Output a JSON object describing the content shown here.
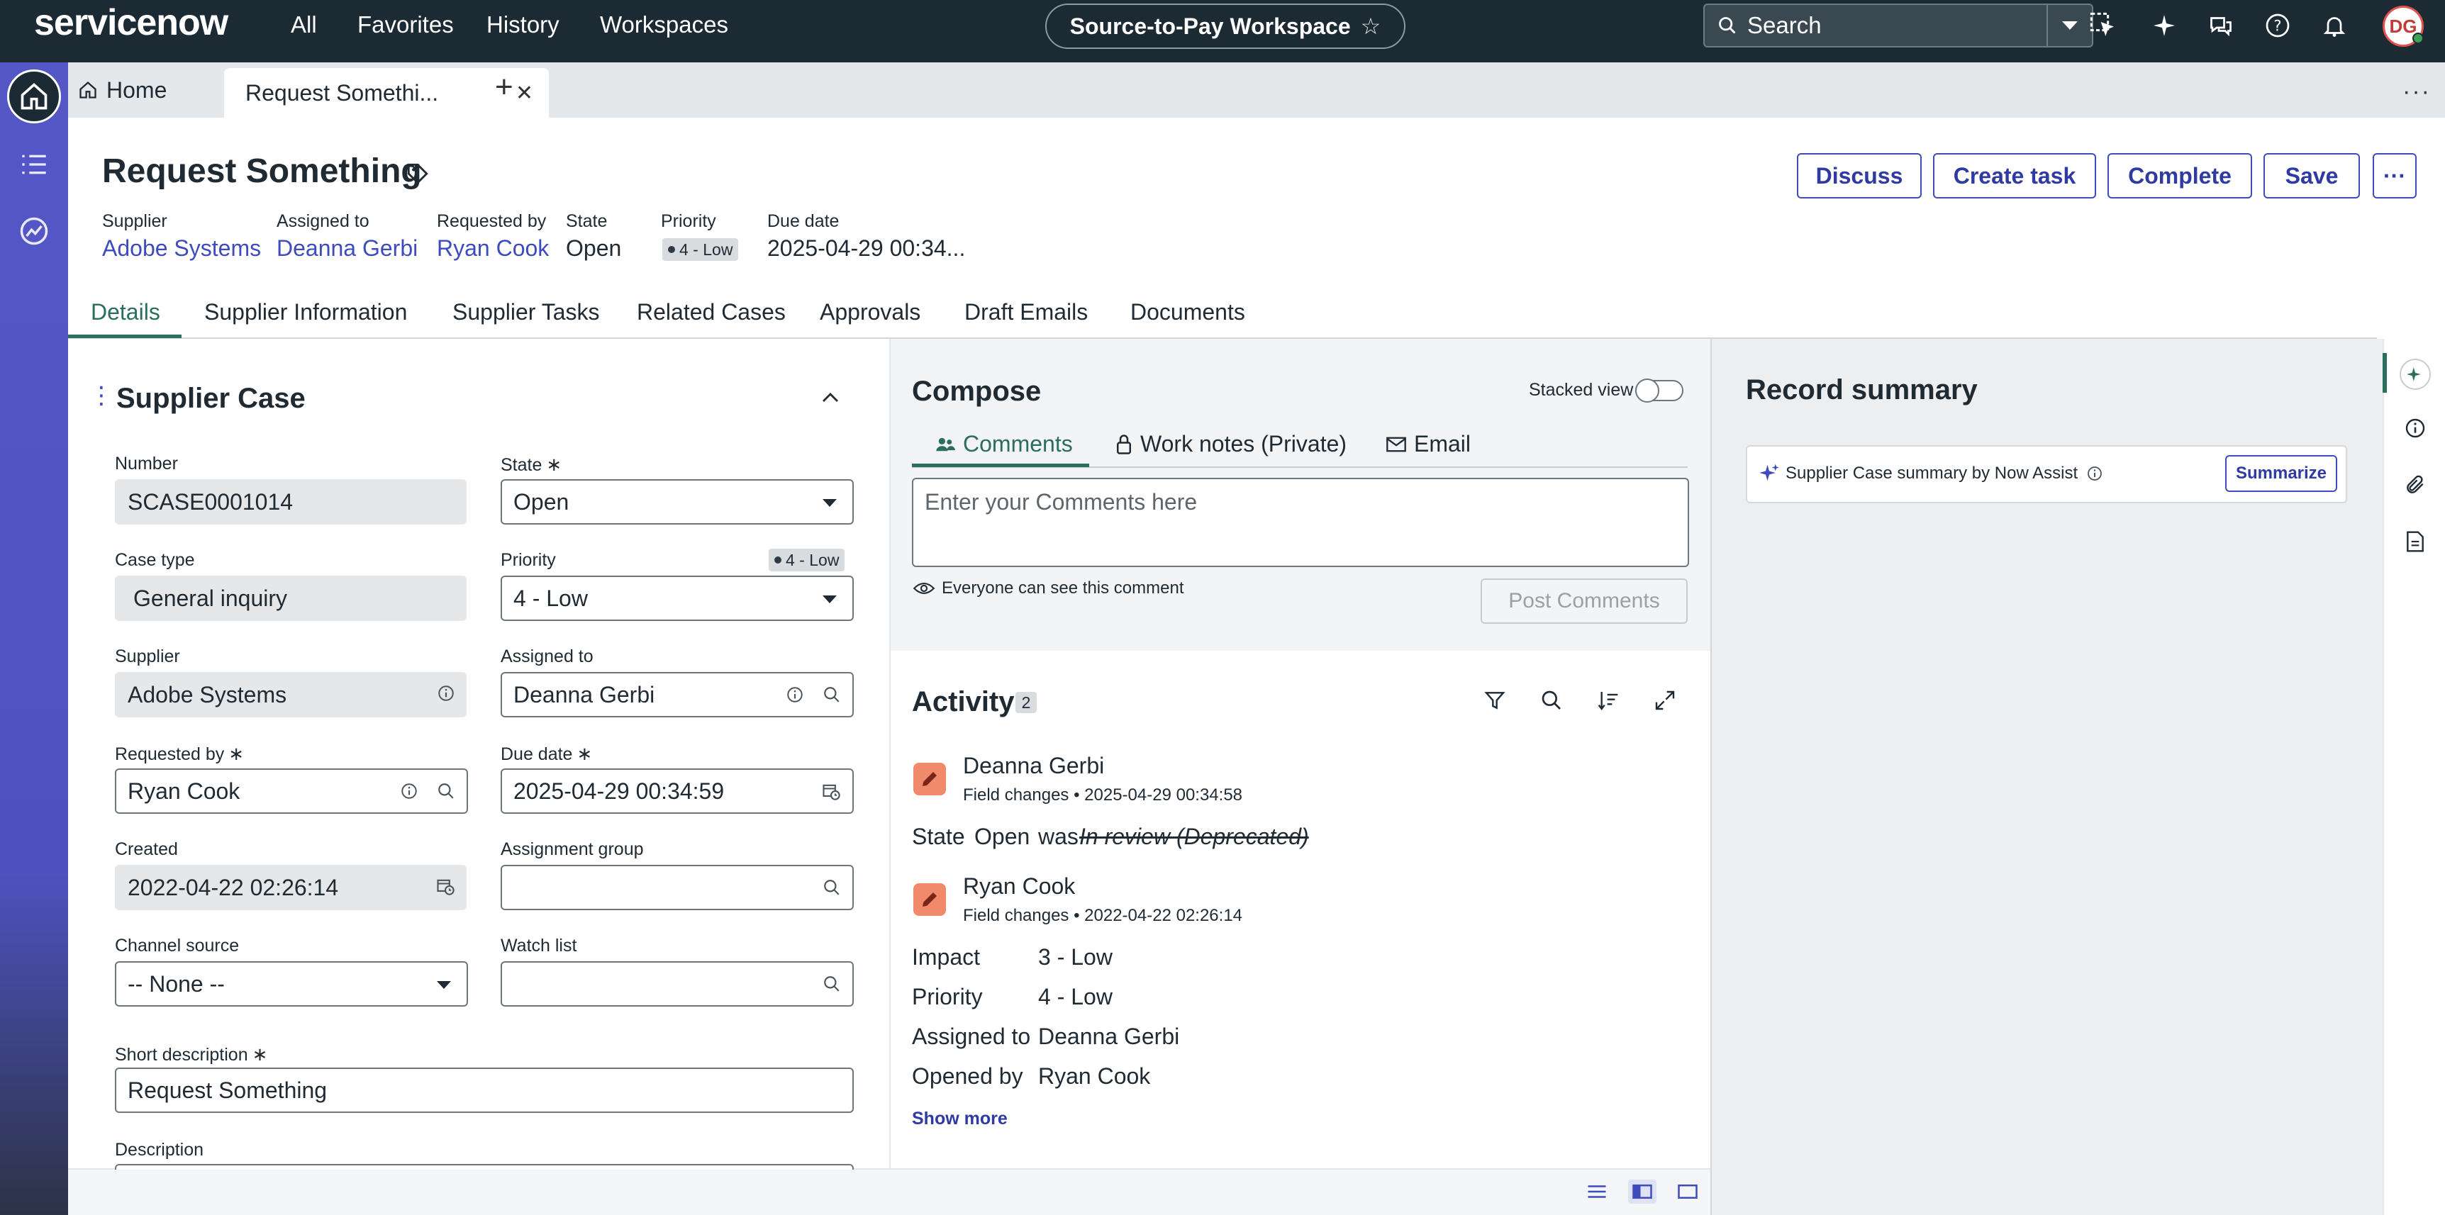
{
  "topbar": {
    "logo": "servicenow",
    "nav": [
      "All",
      "Favorites",
      "History",
      "Workspaces"
    ],
    "workspace": "Source-to-Pay Workspace",
    "search_placeholder": "Search",
    "user_initials": "DG"
  },
  "tabs": {
    "home_label": "Home",
    "active_label": "Request Somethi..."
  },
  "record": {
    "title": "Request Something",
    "meta": [
      {
        "label": "Supplier",
        "value": "Adobe Systems"
      },
      {
        "label": "Assigned to",
        "value": "Deanna Gerbi"
      },
      {
        "label": "Requested by",
        "value": "Ryan Cook"
      },
      {
        "label": "State",
        "value": "Open"
      },
      {
        "label": "Priority",
        "value": "4 - Low"
      },
      {
        "label": "Due date",
        "value": "2025-04-29 00:34..."
      }
    ],
    "buttons": [
      "Discuss",
      "Create task",
      "Complete",
      "Save",
      "···"
    ]
  },
  "form_tabs": [
    "Details",
    "Supplier Information",
    "Supplier Tasks",
    "Related Cases",
    "Approvals",
    "Draft Emails",
    "Documents"
  ],
  "form": {
    "section_title": "Supplier Case",
    "number_label": "Number",
    "number": "SCASE0001014",
    "state_label": "State",
    "state": "Open",
    "case_type_label": "Case type",
    "case_type": "General inquiry",
    "priority_label": "Priority",
    "priority": "4 - Low",
    "priority_badge": "4 - Low",
    "supplier_label": "Supplier",
    "supplier": "Adobe Systems",
    "assigned_label": "Assigned to",
    "assigned": "Deanna Gerbi",
    "requested_label": "Requested by",
    "requested": "Ryan Cook",
    "due_label": "Due date",
    "due": "2025-04-29 00:34:59",
    "created_label": "Created",
    "created": "2022-04-22 02:26:14",
    "group_label": "Assignment group",
    "group": "",
    "channel_label": "Channel source",
    "channel": "-- None --",
    "watch_label": "Watch list",
    "watch": "",
    "short_label": "Short description",
    "short": "Request Something",
    "desc_label": "Description",
    "required_mark": "∗"
  },
  "compose": {
    "title": "Compose",
    "stacked_label": "Stacked view",
    "tabs": [
      "Comments",
      "Work notes (Private)",
      "Email"
    ],
    "placeholder": "Enter your Comments here",
    "visibility": "Everyone can see this comment",
    "post_label": "Post Comments"
  },
  "activity": {
    "title": "Activity",
    "count": "2",
    "entries": [
      {
        "name": "Deanna Gerbi",
        "sub": "Field changes • 2025-04-29 00:34:58"
      },
      {
        "name": "Ryan Cook",
        "sub": "Field changes • 2022-04-22 02:26:14"
      }
    ],
    "change1": {
      "field": "State",
      "new": "Open",
      "was": "was",
      "old": "In review (Deprecated)"
    },
    "change2": [
      {
        "field": "Impact",
        "value": "3 - Low"
      },
      {
        "field": "Priority",
        "value": "4 - Low"
      },
      {
        "field": "Assigned to",
        "value": "Deanna Gerbi"
      },
      {
        "field": "Opened by",
        "value": "Ryan Cook"
      }
    ],
    "show_more": "Show more"
  },
  "summary": {
    "title": "Record summary",
    "text": "Supplier Case summary by Now Assist",
    "button": "Summarize"
  },
  "colors": {
    "nav_bg": "#1b2a33",
    "rail": "#5557c7",
    "accent_green": "#2a6e5b",
    "link": "#3d4bbf"
  }
}
